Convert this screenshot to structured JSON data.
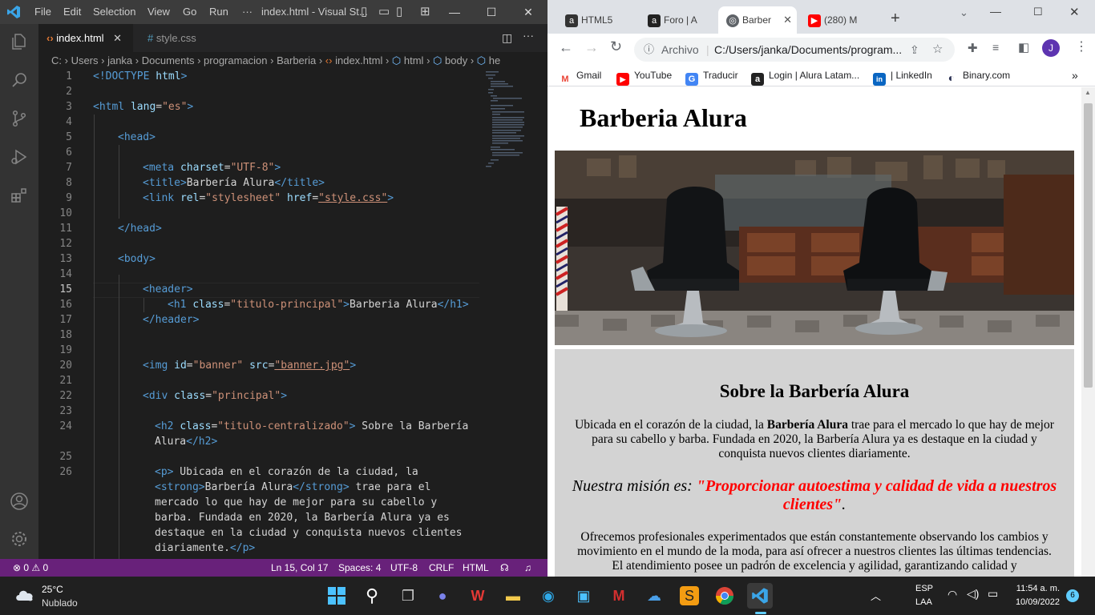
{
  "vscode": {
    "title": "index.html - Visual St...",
    "menu": [
      "File",
      "Edit",
      "Selection",
      "View",
      "Go",
      "Run",
      "···"
    ],
    "tabs": [
      {
        "icon": "html-file-icon",
        "label": "index.html",
        "active": true
      },
      {
        "icon": "css-file-icon",
        "label": "style.css",
        "active": false
      }
    ],
    "breadcrumb": [
      "C:",
      "Users",
      "janka",
      "Documents",
      "programacion",
      "Barberia",
      "index.html",
      "html",
      "body",
      "he"
    ],
    "lines": [
      {
        "n": "1"
      },
      {
        "n": "2"
      },
      {
        "n": "3"
      },
      {
        "n": "4"
      },
      {
        "n": "5"
      },
      {
        "n": "6"
      },
      {
        "n": "7"
      },
      {
        "n": "8"
      },
      {
        "n": "9"
      },
      {
        "n": "10"
      },
      {
        "n": "11"
      },
      {
        "n": "12"
      },
      {
        "n": "13"
      },
      {
        "n": "14"
      },
      {
        "n": "15"
      },
      {
        "n": "16"
      },
      {
        "n": "17"
      },
      {
        "n": "18"
      },
      {
        "n": "19"
      },
      {
        "n": "20"
      },
      {
        "n": "21"
      },
      {
        "n": "22"
      },
      {
        "n": "23"
      },
      {
        "n": "24"
      },
      {
        "n": "25"
      },
      {
        "n": "26"
      }
    ],
    "code": {
      "doctype": "<!DOCTYPE",
      "doctype_html": "html",
      "doctype_close": ">",
      "html_open": "<html",
      "lang_attr": "lang",
      "lang_val": "\"es\"",
      "head_open": "<head>",
      "meta": "<meta",
      "charset_attr": "charset",
      "charset_val": "\"UTF-8\"",
      "title_open": "<title>",
      "title_text": "Barbería Alura",
      "title_close": "</title>",
      "link": "<link",
      "rel_attr": "rel",
      "rel_val": "\"stylesheet\"",
      "href_attr": "href",
      "href_val": "\"style.css\"",
      "head_close": "</head>",
      "body_open": "<body>",
      "header_open": "<header>",
      "h1_open": "<h1",
      "class_attr": "class",
      "h1_class": "\"titulo-principal\"",
      "h1_text": "Barberia Alura",
      "h1_close": "</h1>",
      "header_close": "</header>",
      "img": "<img",
      "id_attr": "id",
      "id_val": "\"banner\"",
      "src_attr": "src",
      "src_val": "\"banner.jpg\"",
      "div": "<div",
      "div_class": "\"principal\"",
      "h2": "<h2",
      "h2_class": "\"titulo-centralizado\"",
      "h2_text_a": " Sobre la Barbería",
      "h2_text_b": "Alura",
      "h2_close": "</h2>",
      "p_open": "<p>",
      "p_text_a": " Ubicada en el corazón de la ciudad, la",
      "strong_open": "<strong>",
      "strong_text": "Barbería Alura",
      "strong_close": "</strong>",
      "p_text_b": " trae para el",
      "p_text_c": "mercado lo que hay de mejor para su cabello y",
      "p_text_d": "barba. Fundada en 2020, la Barbería Alura ya es",
      "p_text_e": "destaque en la ciudad y conquista nuevos clientes",
      "p_text_f": "diariamente.",
      "p_close": "</p>",
      "gt": ">",
      "eq": "="
    },
    "status": {
      "problems": "⊗ 0 ⚠ 0",
      "position": "Ln 15, Col 17",
      "spaces": "Spaces: 4",
      "encoding": "UTF-8",
      "eol": "CRLF",
      "language": "HTML"
    }
  },
  "browser": {
    "tabs": [
      {
        "label": "HTML5",
        "icon": "html5-icon",
        "color": "#333333"
      },
      {
        "label": "Foro | A",
        "icon": "alura-icon",
        "color": "#222222"
      },
      {
        "label": "Barber",
        "icon": "globe-icon",
        "color": "#5f6368",
        "active": true
      },
      {
        "label": "(280) M",
        "icon": "youtube-icon",
        "color": "#ff0000"
      }
    ],
    "address_scheme": "Archivo",
    "address": "C:/Users/janka/Documents/program...",
    "profile_initial": "J",
    "bookmarks": [
      {
        "label": "Gmail",
        "icon": "gmail-icon",
        "glyph": "M",
        "color": "#ea4335"
      },
      {
        "label": "YouTube",
        "icon": "youtube-icon",
        "glyph": "▶",
        "color": "#ff0000"
      },
      {
        "label": "Traducir",
        "icon": "translate-icon",
        "glyph": "G",
        "color": "#4285f4"
      },
      {
        "label": "Login | Alura Latam...",
        "icon": "alura-icon",
        "glyph": "a",
        "color": "#222222"
      },
      {
        "label": "| LinkedIn",
        "icon": "linkedin-icon",
        "glyph": "in",
        "color": "#0a66c2"
      },
      {
        "label": "Binary.com",
        "icon": "binary-icon",
        "glyph": "◐",
        "color": "#2a3052"
      }
    ],
    "page": {
      "h1": "Barberia Alura",
      "h2": "Sobre la Barbería Alura",
      "p1_pre": "Ubicada en el corazón de la ciudad, la ",
      "p1_strong": "Barbería Alura",
      "p1_post": " trae para el mercado lo que hay de mejor para su cabello y barba. Fundada en 2020, la Barbería Alura ya es destaque en la ciudad y conquista nuevos clientes diariamente.",
      "mision_label": "Nuestra misión es: ",
      "mision_quote": "\"Proporcionar autoestima y calidad de vida a nuestros clientes\"",
      "mision_end": ".",
      "p3": "Ofrecemos profesionales experimentados que están constantemente observando los cambios y movimiento en el mundo de la moda, para así ofrecer a nuestros clientes las últimas tendencias. El atendimiento posee un padrón de excelencia y agilidad, garantizando calidad y"
    }
  },
  "taskbar": {
    "weather_temp": "25°C",
    "weather_desc": "Nublado",
    "lang_top": "ESP",
    "lang_bottom": "LAA",
    "time": "11:54 a. m.",
    "date": "10/09/2022",
    "notifications": "6"
  }
}
